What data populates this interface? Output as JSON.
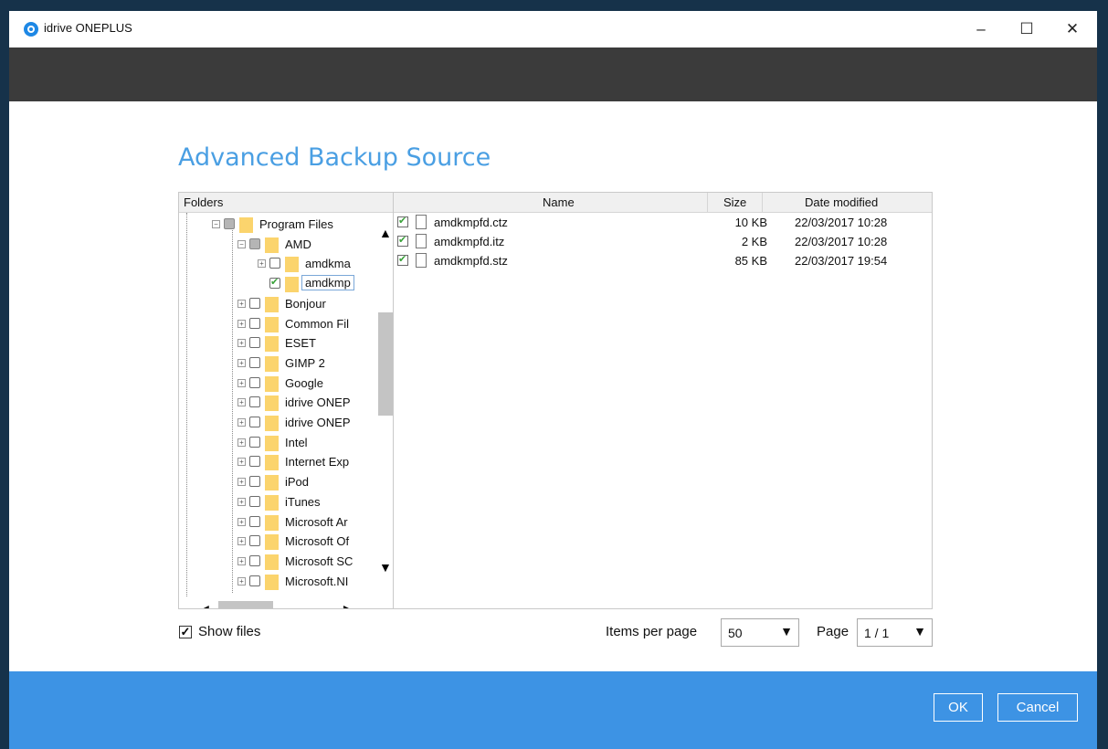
{
  "window": {
    "title": "idrive ONEPLUS",
    "minimize": "–",
    "maximize": "☐",
    "close": "✕"
  },
  "heading": "Advanced Backup Source",
  "folders": {
    "header": "Folders",
    "items": [
      {
        "label": "Program Files",
        "state": "partial",
        "expander": "−"
      },
      {
        "label": "AMD",
        "state": "partial",
        "expander": "−"
      },
      {
        "label": "amdkma",
        "state": "unchecked",
        "expander": "+"
      },
      {
        "label": "amdkmp",
        "state": "checked",
        "expander": ""
      },
      {
        "label": "Bonjour",
        "state": "unchecked",
        "expander": "+"
      },
      {
        "label": "Common Fil",
        "state": "unchecked",
        "expander": "+"
      },
      {
        "label": "ESET",
        "state": "unchecked",
        "expander": "+"
      },
      {
        "label": "GIMP 2",
        "state": "unchecked",
        "expander": "+"
      },
      {
        "label": "Google",
        "state": "unchecked",
        "expander": "+"
      },
      {
        "label": "idrive ONEP",
        "state": "unchecked",
        "expander": "+"
      },
      {
        "label": "idrive ONEP",
        "state": "unchecked",
        "expander": "+"
      },
      {
        "label": "Intel",
        "state": "unchecked",
        "expander": "+"
      },
      {
        "label": "Internet Exp",
        "state": "unchecked",
        "expander": "+"
      },
      {
        "label": "iPod",
        "state": "unchecked",
        "expander": "+"
      },
      {
        "label": "iTunes",
        "state": "unchecked",
        "expander": "+"
      },
      {
        "label": "Microsoft Ar",
        "state": "unchecked",
        "expander": "+"
      },
      {
        "label": "Microsoft Of",
        "state": "unchecked",
        "expander": "+"
      },
      {
        "label": "Microsoft SC",
        "state": "unchecked",
        "expander": "+"
      },
      {
        "label": "Microsoft.NI",
        "state": "unchecked",
        "expander": "+"
      }
    ]
  },
  "files": {
    "columns": {
      "name": "Name",
      "size": "Size",
      "date": "Date modified"
    },
    "rows": [
      {
        "name": "amdkmpfd.ctz",
        "size": "10 KB",
        "date": "22/03/2017 10:28"
      },
      {
        "name": "amdkmpfd.itz",
        "size": "2 KB",
        "date": "22/03/2017 10:28"
      },
      {
        "name": "amdkmpfd.stz",
        "size": "85 KB",
        "date": "22/03/2017 19:54"
      }
    ]
  },
  "controls": {
    "show_files": "Show files",
    "show_files_check": "✓",
    "items_per_page_label": "Items per page",
    "items_per_page": "50",
    "page_label": "Page",
    "page": "1 / 1"
  },
  "footer": {
    "ok": "OK",
    "cancel": "Cancel"
  }
}
